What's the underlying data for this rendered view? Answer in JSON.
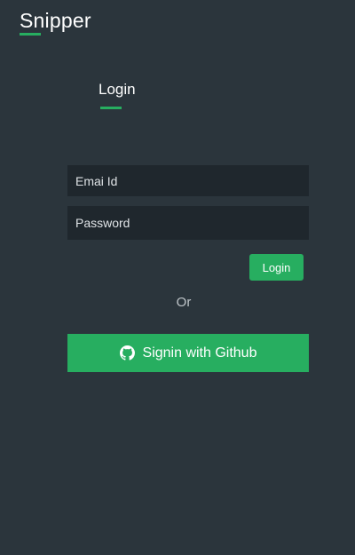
{
  "header": {
    "brand": "Snipper"
  },
  "login_form": {
    "title": "Login",
    "email_placeholder": "Emai Id",
    "password_placeholder": "Password",
    "login_label": "Login",
    "or_text": "Or",
    "github_label": "Signin with Github",
    "github_icon": "github-icon"
  },
  "colors": {
    "background": "#2b353c",
    "input_background": "#1f272d",
    "accent": "#27ae60",
    "text": "#ffffff"
  }
}
